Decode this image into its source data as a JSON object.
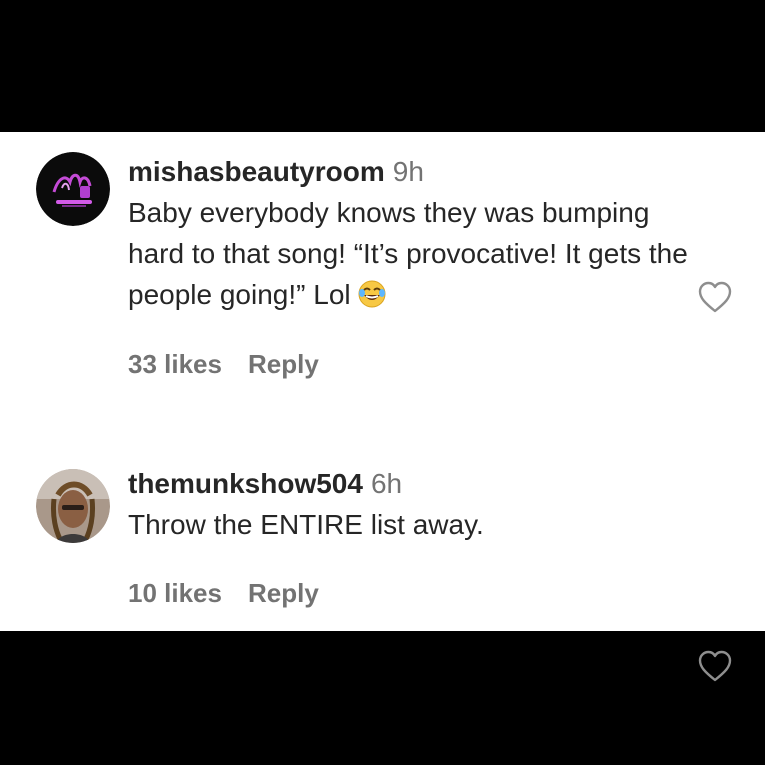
{
  "colors": {
    "background": "#000000",
    "panel": "#ffffff",
    "text": "#262626",
    "muted": "#737373"
  },
  "comments": [
    {
      "username": "mishasbeautyroom",
      "time": "9h",
      "text": "Baby everybody knows they was bumping hard to that song! “It’s provocative! It gets the people going!” Lol",
      "emoji": "face-with-tears-of-joy",
      "likes": "33 likes",
      "reply": "Reply",
      "avatar_icon": "beauty-logo-avatar"
    },
    {
      "username": "themunkshow504",
      "time": "6h",
      "text": "Throw the ENTIRE list away.",
      "likes": "10 likes",
      "reply": "Reply",
      "avatar_icon": "user-photo-avatar"
    }
  ]
}
